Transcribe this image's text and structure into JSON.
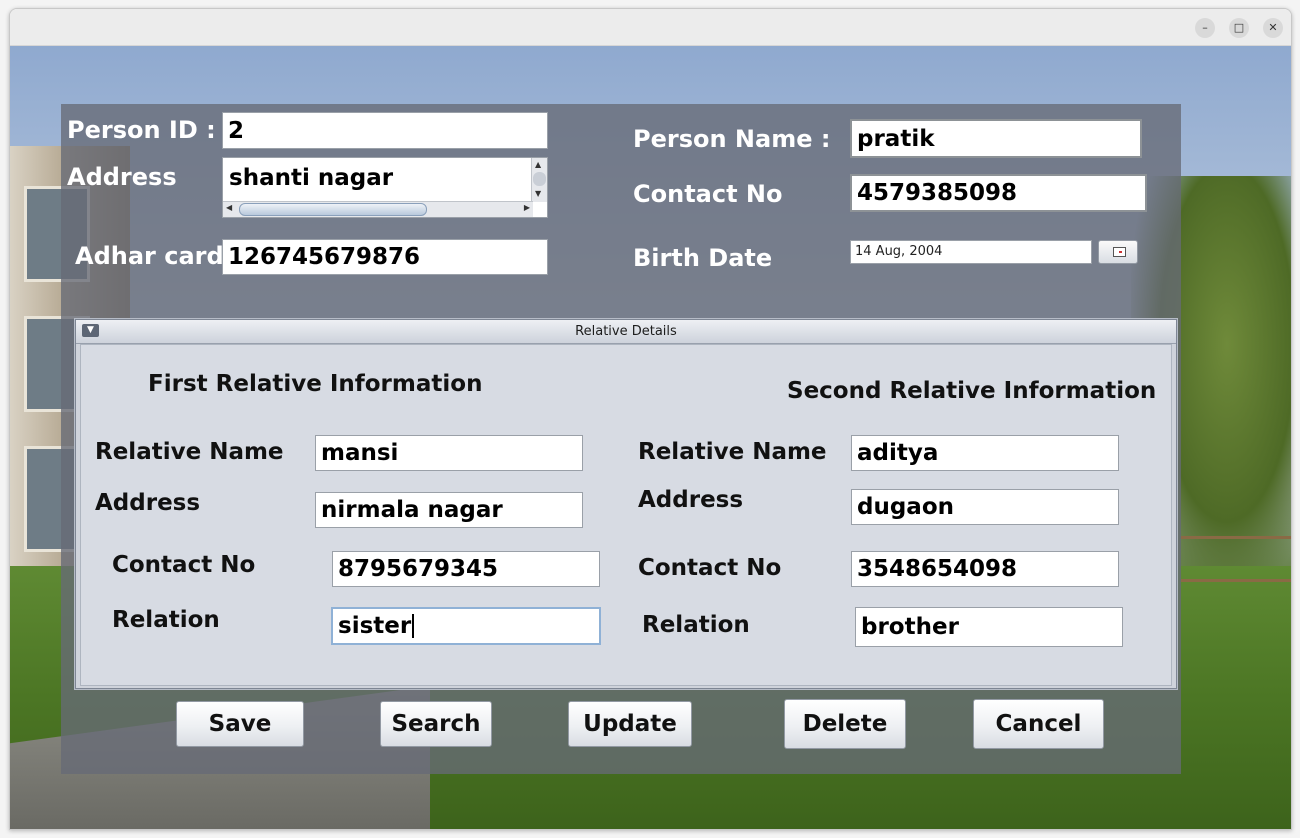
{
  "window": {
    "controls": {
      "minimize": "–",
      "maximize": "□",
      "close": "✕"
    }
  },
  "person": {
    "id_label": "Person ID :",
    "id_value": "2",
    "name_label": "Person Name :",
    "name_value": "pratik",
    "address_label": "Address",
    "address_value": "shanti nagar",
    "contact_label": "Contact No",
    "contact_value": "4579385098",
    "adhar_label": "Adhar card",
    "adhar_value": "126745679876",
    "birth_label": "Birth Date",
    "birth_value": "14 Aug, 2004",
    "calendar_icon": "calendar-icon"
  },
  "relative_details": {
    "title": "Relative Details",
    "collapse_icon": "collapse-icon",
    "first": {
      "heading": "First Relative Information",
      "name_label": "Relative Name",
      "name_value": "mansi",
      "address_label": "Address",
      "address_value": "nirmala nagar",
      "contact_label": "Contact No",
      "contact_value": "8795679345",
      "relation_label": "Relation",
      "relation_value": "sister"
    },
    "second": {
      "heading": "Second Relative Information",
      "name_label": "Relative Name",
      "name_value": "aditya",
      "address_label": "Address",
      "address_value": "dugaon",
      "contact_label": "Contact No",
      "contact_value": "3548654098",
      "relation_label": "Relation",
      "relation_value": "brother"
    }
  },
  "buttons": {
    "save": "Save",
    "search": "Search",
    "update": "Update",
    "delete": "Delete",
    "cancel": "Cancel"
  },
  "colors": {
    "overlay": "#666a76",
    "panel_bg": "#d7dbe3",
    "label_text": "#ffffff"
  }
}
